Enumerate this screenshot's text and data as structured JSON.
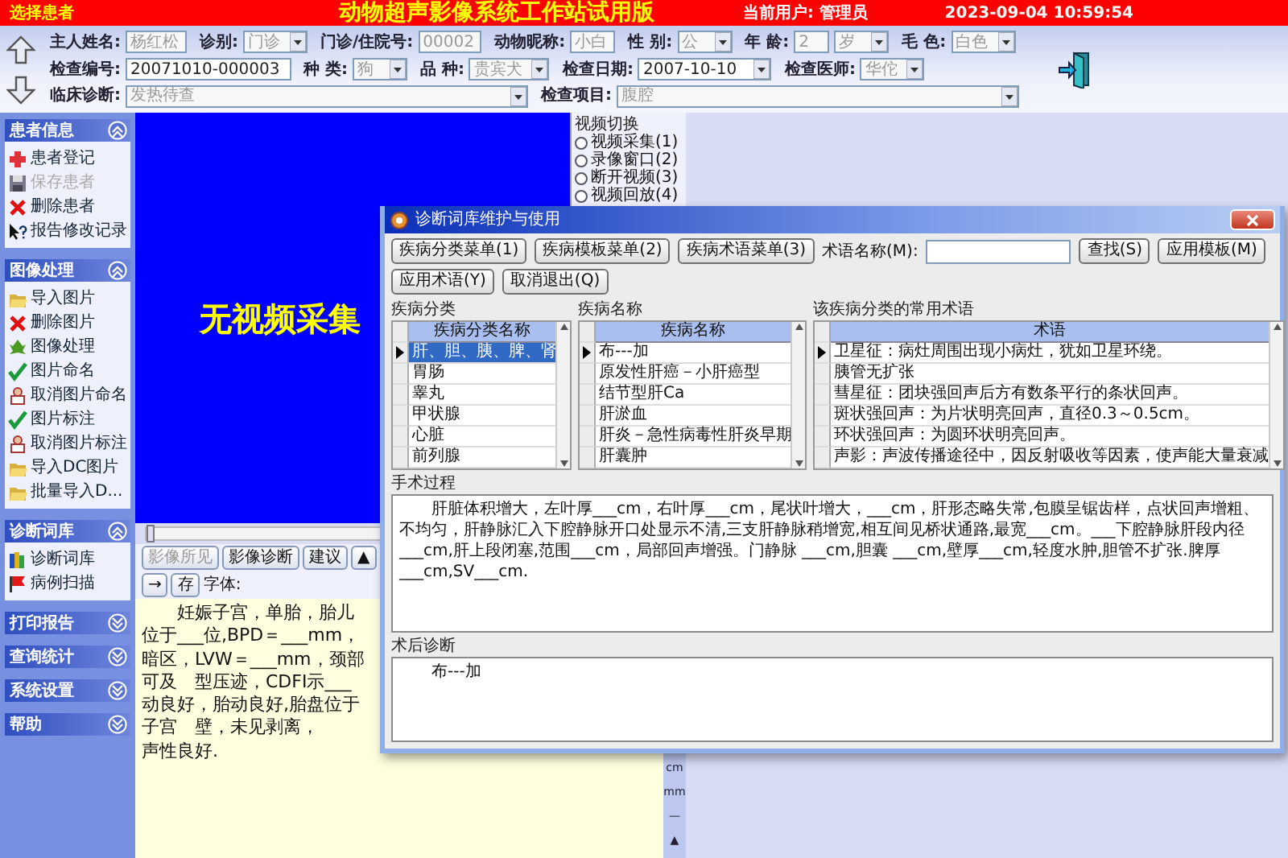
{
  "header": {
    "patient_button": "选择患者",
    "title": "动物超声影像系统工作站试用版",
    "user": "当前用户: 管理员",
    "datetime": "2023-09-04 10:59:54"
  },
  "patient_form": {
    "lines": [
      {
        "fields": [
          {
            "label": "主人姓名:",
            "kind": "input",
            "value": "杨红松",
            "disabled": true
          },
          {
            "label": "诊别:",
            "kind": "select",
            "value": "门诊",
            "disabled": true
          },
          {
            "label": "门诊/住院号:",
            "kind": "input",
            "value": "00002",
            "disabled": true
          },
          {
            "label": "动物昵称:",
            "kind": "input",
            "value": "小白",
            "disabled": true
          },
          {
            "label": "性 别:",
            "kind": "select",
            "value": "公",
            "disabled": true
          },
          {
            "label": "年 龄:",
            "kind": "input",
            "value": "2",
            "disabled": true
          },
          {
            "kind": "select",
            "value": "岁",
            "disabled": true
          },
          {
            "label": "毛 色:",
            "kind": "select",
            "value": "白色",
            "disabled": true
          }
        ]
      },
      {
        "fields": [
          {
            "label": "检查编号:",
            "kind": "input",
            "value": "20071010-000003",
            "disabled": false
          },
          {
            "label": "种 类:",
            "kind": "select",
            "value": "狗",
            "disabled": true
          },
          {
            "label": "品 种:",
            "kind": "select",
            "value": "贵宾犬",
            "disabled": true
          },
          {
            "label": "检查日期:",
            "kind": "select",
            "value": "2007-10-10",
            "disabled": false
          },
          {
            "label": "检查医师:",
            "kind": "select",
            "value": "华佗",
            "disabled": true
          }
        ]
      },
      {
        "fields": [
          {
            "label": "临床诊断:",
            "kind": "select",
            "value": "发热待查",
            "disabled": true
          },
          {
            "label": "检查项目:",
            "kind": "select",
            "value": "腹腔",
            "disabled": true
          }
        ]
      }
    ]
  },
  "sidebar": [
    {
      "title": "患者信息",
      "expanded": true,
      "items": [
        {
          "label": "患者登记",
          "kind": "add",
          "disabled": false
        },
        {
          "label": "保存患者",
          "kind": "save",
          "disabled": true
        },
        {
          "label": "删除患者",
          "kind": "delete",
          "disabled": false
        },
        {
          "label": "报告修改记录",
          "kind": "help",
          "disabled": false
        }
      ]
    },
    {
      "title": "图像处理",
      "expanded": true,
      "items": [
        {
          "label": "导入图片",
          "kind": "folder",
          "disabled": false
        },
        {
          "label": "删除图片",
          "kind": "delete",
          "disabled": false
        },
        {
          "label": "图像处理",
          "kind": "process",
          "disabled": false
        },
        {
          "label": "图片命名",
          "kind": "check",
          "disabled": false
        },
        {
          "label": "取消图片命名",
          "kind": "stamp",
          "disabled": false
        },
        {
          "label": "图片标注",
          "kind": "check",
          "disabled": false
        },
        {
          "label": "取消图片标注",
          "kind": "stamp",
          "disabled": false
        },
        {
          "label": "导入DC图片",
          "kind": "folder",
          "disabled": false
        },
        {
          "label": "批量导入D...",
          "kind": "folder",
          "disabled": false
        }
      ]
    },
    {
      "title": "诊断词库",
      "expanded": true,
      "items": [
        {
          "label": "诊断词库",
          "kind": "books",
          "disabled": false
        },
        {
          "label": "病例扫描",
          "kind": "flag",
          "disabled": false
        }
      ]
    },
    {
      "title": "打印报告",
      "expanded": false
    },
    {
      "title": "查询统计",
      "expanded": false
    },
    {
      "title": "系统设置",
      "expanded": false
    },
    {
      "title": "帮助",
      "expanded": false
    }
  ],
  "video": {
    "message": "无视频采集"
  },
  "video_switch": {
    "title": "视频切换",
    "options": [
      {
        "label": "视频采集(1)",
        "selected": false
      },
      {
        "label": "录像窗口(2)",
        "selected": false
      },
      {
        "label": "断开视频(3)",
        "selected": false
      },
      {
        "label": "视频回放(4)",
        "selected": false
      }
    ]
  },
  "slider": {
    "level": 0
  },
  "editor_toolbar": {
    "buttons": [
      {
        "label": "影像所见",
        "disabled": true
      },
      {
        "label": "影像诊断",
        "disabled": false
      },
      {
        "label": "建议",
        "disabled": false
      },
      {
        "label": "▲",
        "disabled": false
      },
      {
        "label": "→",
        "disabled": false
      },
      {
        "label": "存",
        "disabled": false
      }
    ],
    "font_label": "字体:"
  },
  "report_text": [
    "妊娠子宫，单胎，胎儿位于___位,BPD＝___mm，",
    "暗区，LVW＝___mm，颈部可及　型压迹，CDFI示___",
    "动良好，胎动良好,胎盘位于子宫　壁，未见剥离，",
    "声性良好."
  ],
  "unit_buttons": [
    "cm",
    "mm",
    "—",
    "▲"
  ],
  "dialog": {
    "title": "诊断词库维护与使用",
    "toolbar": [
      {
        "kind": "button",
        "label": "疾病分类菜单(1)"
      },
      {
        "kind": "button",
        "label": "疾病模板菜单(2)"
      },
      {
        "kind": "button",
        "label": "疾病术语菜单(3)"
      },
      {
        "kind": "label",
        "label": "术语名称(M):"
      },
      {
        "kind": "field"
      },
      {
        "kind": "button",
        "label": "查找(S)"
      },
      {
        "kind": "button",
        "label": "应用模板(M)"
      },
      {
        "kind": "button",
        "label": "应用术语(Y)"
      },
      {
        "kind": "button",
        "label": "取消退出(Q)"
      }
    ],
    "panels": [
      {
        "title": "疾病分类",
        "column": "疾病分类名称",
        "rows": [
          {
            "text": "肝、胆、胰、脾、肾",
            "current": true,
            "selected": true
          },
          {
            "text": "胃肠",
            "current": false,
            "selected": false
          },
          {
            "text": "睾丸",
            "current": false,
            "selected": false
          },
          {
            "text": "甲状腺",
            "current": false,
            "selected": false
          },
          {
            "text": "心脏",
            "current": false,
            "selected": false
          },
          {
            "text": "前列腺",
            "current": false,
            "selected": false
          }
        ]
      },
      {
        "title": "疾病名称",
        "column": "疾病名称",
        "rows": [
          {
            "text": "布---加",
            "current": true,
            "selected": false
          },
          {
            "text": "原发性肝癌－小肝癌型",
            "current": false,
            "selected": false
          },
          {
            "text": "结节型肝Ca",
            "current": false,
            "selected": false
          },
          {
            "text": "肝淤血",
            "current": false,
            "selected": false
          },
          {
            "text": "肝炎－急性病毒性肝炎早期",
            "current": false,
            "selected": false
          },
          {
            "text": "肝囊肿",
            "current": false,
            "selected": false
          }
        ]
      },
      {
        "title": "该疾病分类的常用术语",
        "column": "术语",
        "rows": [
          {
            "text": "卫星征：病灶周围出现小病灶，犹如卫星环绕。",
            "current": true,
            "selected": false
          },
          {
            "text": "胰管无扩张",
            "current": false,
            "selected": false
          },
          {
            "text": "彗星征：团块强回声后方有数条平行的条状回声。",
            "current": false,
            "selected": false
          },
          {
            "text": "斑状强回声：为片状明亮回声，直径0.3～0.5cm。",
            "current": false,
            "selected": false
          },
          {
            "text": "环状强回声：为圆环状明亮回声。",
            "current": false,
            "selected": false
          },
          {
            "text": "声影：声波传播途径中，因反射吸收等因素，使声能大量衰减",
            "current": false,
            "selected": false
          }
        ]
      }
    ],
    "procedure": {
      "title": "手术过程",
      "text": "肝脏体积增大，左叶厚___cm，右叶厚___cm，尾状叶增大，___cm，肝形态略失常,包膜呈锯齿样，点状回声增粗、不均匀，肝静脉汇入下腔静脉开口处显示不清,三支肝静脉稍增宽,相互间见桥状通路,最宽___cm。___下腔静脉肝段内径___cm,肝上段闭塞,范围___cm，局部回声增强。门静脉 ___cm,胆囊 ___cm,壁厚___cm,轻度水肿,胆管不扩张.脾厚___cm,SV___cm."
    },
    "diagnosis": {
      "title": "术后诊断",
      "text": "布---加"
    }
  }
}
